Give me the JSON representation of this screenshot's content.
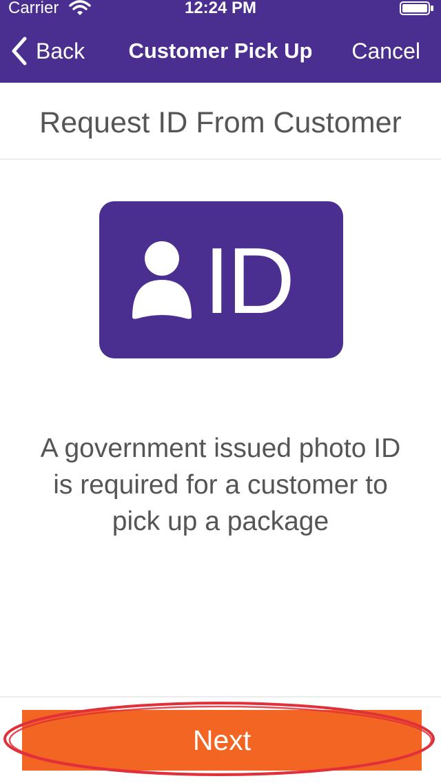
{
  "status_bar": {
    "carrier": "Carrier",
    "time": "12:24 PM",
    "icons": [
      "wifi-icon",
      "battery-icon"
    ]
  },
  "nav": {
    "back_label": "Back",
    "title": "Customer Pick Up",
    "cancel_label": "Cancel",
    "icons": [
      "chevron-left-icon"
    ]
  },
  "page": {
    "title": "Request ID From Customer",
    "id_card_label": "ID",
    "id_card_icon": "person-icon",
    "description": "A government issued photo ID is required for a customer to pick up a package"
  },
  "footer": {
    "next_label": "Next"
  },
  "colors": {
    "brand_purple": "#4a2f91",
    "accent_orange": "#f26522",
    "highlight_red": "#e0303a",
    "text_gray": "#555555"
  }
}
